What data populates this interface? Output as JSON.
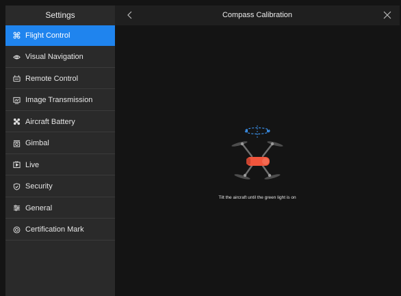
{
  "sidebar": {
    "title": "Settings",
    "items": [
      {
        "label": "Flight Control",
        "icon": "drone-icon",
        "active": true
      },
      {
        "label": "Visual Navigation",
        "icon": "eye-icon",
        "active": false
      },
      {
        "label": "Remote Control",
        "icon": "remote-controller-icon",
        "active": false
      },
      {
        "label": "Image Transmission",
        "icon": "image-transmission-icon",
        "active": false
      },
      {
        "label": "Aircraft Battery",
        "icon": "battery-icon",
        "active": false
      },
      {
        "label": "Gimbal",
        "icon": "gimbal-camera-icon",
        "active": false
      },
      {
        "label": "Live",
        "icon": "live-stream-icon",
        "active": false
      },
      {
        "label": "Security",
        "icon": "shield-icon",
        "active": false
      },
      {
        "label": "General",
        "icon": "sliders-icon",
        "active": false
      },
      {
        "label": "Certification Mark",
        "icon": "certification-icon",
        "active": false
      }
    ]
  },
  "header": {
    "title": "Compass Calibration",
    "back_icon": "chevron-left-icon",
    "close_icon": "close-icon"
  },
  "calibration": {
    "hint": "Tilt the aircraft until the green light is on",
    "illustration_icon": "aircraft-compass-illustration",
    "colors": {
      "accent": "#1f84ee",
      "aircraft_body": "#f0553c",
      "arrow": "#3a8ee6"
    }
  }
}
